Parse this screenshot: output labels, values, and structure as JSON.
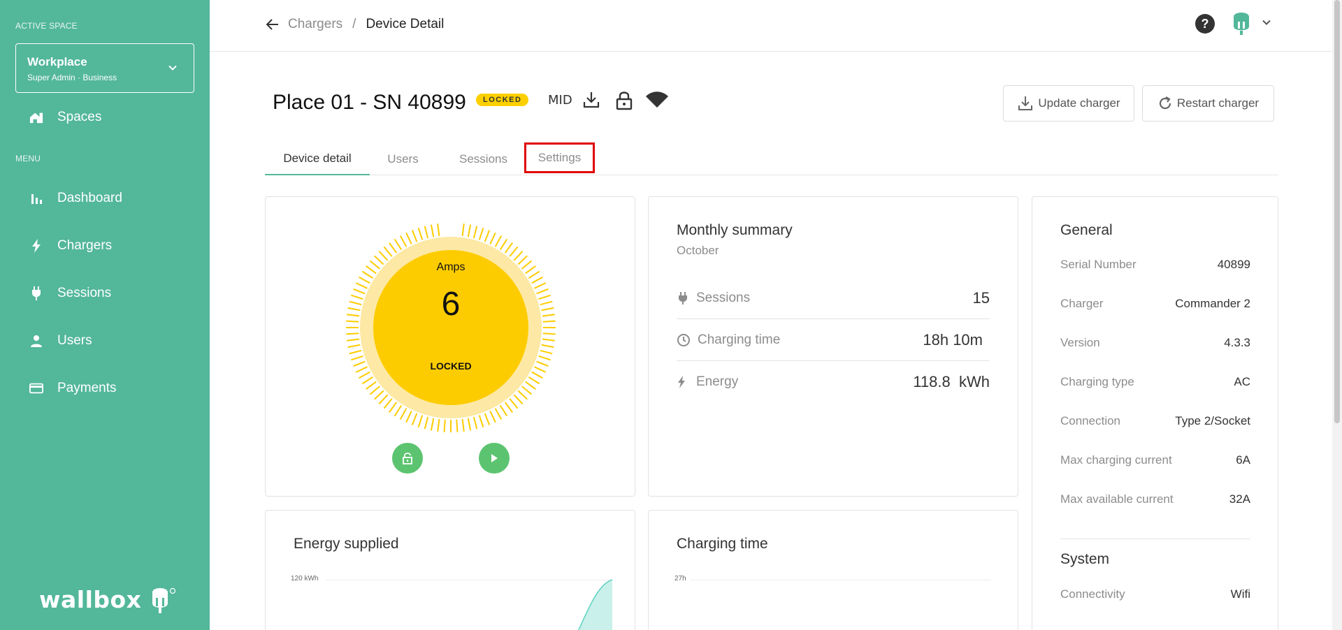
{
  "sidebar": {
    "active_space_label": "ACTIVE SPACE",
    "space_name": "Workplace",
    "space_sub": "Super Admin · Business",
    "spaces_label": "Spaces",
    "menu_label": "MENU",
    "items": [
      {
        "label": "Dashboard",
        "icon": "bar-chart-icon"
      },
      {
        "label": "Chargers",
        "icon": "bolt-icon"
      },
      {
        "label": "Sessions",
        "icon": "plug-icon"
      },
      {
        "label": "Users",
        "icon": "person-icon"
      },
      {
        "label": "Payments",
        "icon": "credit-card-icon"
      }
    ],
    "logo_text": "wallbox",
    "bg_color": "#53b79a"
  },
  "topbar": {
    "breadcrumb_parent": "Chargers",
    "breadcrumb_sep": "/",
    "breadcrumb_current": "Device Detail",
    "help": "?"
  },
  "header": {
    "title": "Place 01 - SN 40899",
    "badge": "LOCKED",
    "mid": "MID",
    "update_label": "Update charger",
    "restart_label": "Restart charger"
  },
  "tabs": [
    {
      "label": "Device detail",
      "active": true
    },
    {
      "label": "Users",
      "active": false
    },
    {
      "label": "Sessions",
      "active": false
    },
    {
      "label": "Settings",
      "active": false,
      "highlighted": true
    }
  ],
  "gauge": {
    "unit": "Amps",
    "value": "6",
    "status": "LOCKED",
    "color": "#fdcc00"
  },
  "monthly": {
    "title": "Monthly summary",
    "month": "October",
    "rows": [
      {
        "label": "Sessions",
        "value": "15",
        "icon": "plug-icon"
      },
      {
        "label": "Charging time",
        "value": "18h 10m",
        "icon": "clock-icon"
      },
      {
        "label": "Energy",
        "value": "118.8  kWh",
        "icon": "bolt-icon"
      }
    ]
  },
  "general": {
    "title": "General",
    "rows": [
      {
        "label": "Serial Number",
        "value": "40899"
      },
      {
        "label": "Charger",
        "value": "Commander 2"
      },
      {
        "label": "Version",
        "value": "4.3.3"
      },
      {
        "label": "Charging type",
        "value": "AC"
      },
      {
        "label": "Connection",
        "value": "Type 2/Socket"
      },
      {
        "label": "Max charging current",
        "value": "6A"
      },
      {
        "label": "Max available current",
        "value": "32A"
      }
    ],
    "system_title": "System",
    "system_rows": [
      {
        "label": "Connectivity",
        "value": "Wifi"
      }
    ]
  },
  "energy_chart": {
    "title": "Energy supplied",
    "top_tick": "120 kWh"
  },
  "time_chart": {
    "title": "Charging time",
    "top_tick": "27h"
  }
}
